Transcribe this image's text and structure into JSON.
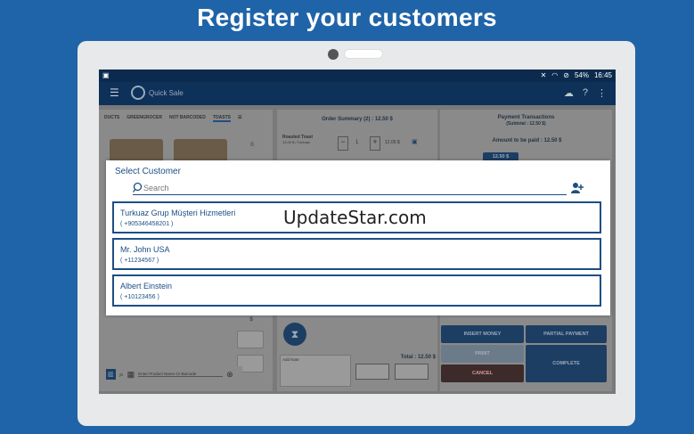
{
  "headline": "Register your customers",
  "status_bar": {
    "battery": "54%",
    "time": "16:45"
  },
  "app_bar": {
    "title": "Quick Sale"
  },
  "left_panel": {
    "tabs": [
      "DUCTS",
      "GREENGROCER",
      "NOT BARCODED",
      "TOASTS"
    ],
    "active_tab": "TOASTS",
    "counter": "0",
    "item_badge": "x1.0",
    "search_placeholder": "Enter Product Name Or Barcode",
    "side_values": [
      "$"
    ]
  },
  "middle_panel": {
    "title": "Order Summary (2) : 12.50 $",
    "order_item": {
      "name": "Roasted Toast",
      "detail": "12.00 $ / Turkuaz",
      "qty": "1",
      "price": "12.00 $"
    },
    "add_note": "Add Note",
    "total": "Total : 12.50 $"
  },
  "right_panel": {
    "title": "Payment Transactions",
    "subtitle": "(Subtotal : 12.50 $)",
    "amount": "Amount to be paid : 12.50 $",
    "amount_chip": "12.50 $",
    "buttons": {
      "insert_money": "INSERT MONEY",
      "partial_payment": "PARTIAL PAYMENT",
      "print": "PRINT",
      "cancel": "CANCEL",
      "complete": "COMPLETE"
    }
  },
  "modal": {
    "title": "Select Customer",
    "search_placeholder": "Search",
    "customers": [
      {
        "name": "Turkuaz Grup Müşteri Hizmetleri",
        "phone": "( +905346458201 )"
      },
      {
        "name": "Mr. John USA",
        "phone": "( +11234567 )"
      },
      {
        "name": "Albert Einstein",
        "phone": "( +10123456 )"
      }
    ]
  },
  "watermark": "UpdateStar.com",
  "colors": {
    "background": "#1f64a8",
    "accent": "#1d4e84",
    "appbar": "#0d3158"
  }
}
